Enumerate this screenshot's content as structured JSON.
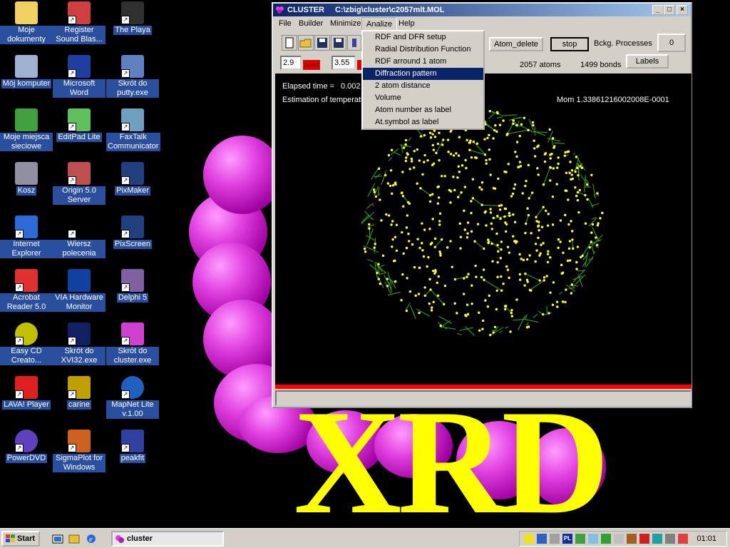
{
  "desktop": {
    "icons": [
      {
        "label": "Moje dokumenty",
        "icon": "folder-icon"
      },
      {
        "label": "Register Sound Blas...",
        "icon": "sound-icon"
      },
      {
        "label": "The Playa",
        "icon": "app-icon"
      },
      {
        "label": "Mój komputer",
        "icon": "computer-icon"
      },
      {
        "label": "Microsoft Word",
        "icon": "word-icon"
      },
      {
        "label": "Skrót do putty.exe",
        "icon": "putty-icon"
      },
      {
        "label": "Moje miejsca sieciowe",
        "icon": "network-icon"
      },
      {
        "label": "EditPad Lite",
        "icon": "editpad-icon"
      },
      {
        "label": "FaxTalk Communicator",
        "icon": "fax-icon"
      },
      {
        "label": "Kosz",
        "icon": "trash-icon"
      },
      {
        "label": "Origin 5.0 Server",
        "icon": "origin-icon"
      },
      {
        "label": "PixMaker",
        "icon": "pixmaker-icon"
      },
      {
        "label": "Internet Explorer",
        "icon": "ie-icon"
      },
      {
        "label": "Wiersz polecenia",
        "icon": "cmd-icon"
      },
      {
        "label": "PixScreen",
        "icon": "pixscreen-icon"
      },
      {
        "label": "Acrobat Reader 5.0",
        "icon": "acrobat-icon"
      },
      {
        "label": "VIA Hardware Monitor",
        "icon": "via-icon"
      },
      {
        "label": "Delphi 5",
        "icon": "delphi-icon"
      },
      {
        "label": "Easy CD Creato...",
        "icon": "cd-icon"
      },
      {
        "label": "Skrót do XVI32.exe",
        "icon": "hex-icon"
      },
      {
        "label": "Skrót do cluster.exe",
        "icon": "xrd-icon"
      },
      {
        "label": "LAVA! Player",
        "icon": "mp3-icon"
      },
      {
        "label": "carine",
        "icon": "carine-icon"
      },
      {
        "label": "MapNet Lite v.1.00",
        "icon": "globe-icon"
      },
      {
        "label": "PowerDVD",
        "icon": "dvd-icon"
      },
      {
        "label": "SigmaPlot for Windows",
        "icon": "sigmaplot-icon"
      },
      {
        "label": "peakfit",
        "icon": "peakfit-icon"
      }
    ],
    "wallpaper_text": "XRD"
  },
  "window": {
    "title": "CLUSTER",
    "path": "C:\\zbig\\cluster\\c2057mlt.MOL",
    "buttons": {
      "minimize": "_",
      "maximize": "□",
      "close": "×"
    },
    "menu": [
      "File",
      "Builder",
      "Minimize",
      "Analize",
      "Help"
    ],
    "toolbar": {
      "field1": "2.9",
      "field1_label": "bond",
      "field2": "3.55",
      "atom_delete": "Atom_delete",
      "stop": "stop",
      "processes_label": "Bckg. Processes",
      "processes_value": "0",
      "labels": "Labels",
      "atoms": "2057 atoms",
      "bonds": "1499 bonds"
    },
    "plot": {
      "elapsed_label": "Elapsed time =",
      "elapsed_value": "0.002",
      "estimation_label": "Estimation of temperatur",
      "mom": "Mom  1.33861216002008E-0001"
    },
    "analize_menu": [
      "RDF and DFR setup",
      "Radial Distribution Function",
      "RDF arround 1 atom",
      "Diffraction pattern",
      "2 atom distance",
      "Volume",
      "Atom number as label",
      "At.symbol as label"
    ],
    "analize_highlighted": "Diffraction pattern"
  },
  "taskbar": {
    "start": "Start",
    "task": "cluster",
    "clock": "01:01",
    "tray_lang": "PL"
  },
  "colors": {
    "titlebar": "#0a246a",
    "progress_red": "#ff0000",
    "atom_yellow": "#ffff40",
    "bond_green": "#3aa82a"
  }
}
